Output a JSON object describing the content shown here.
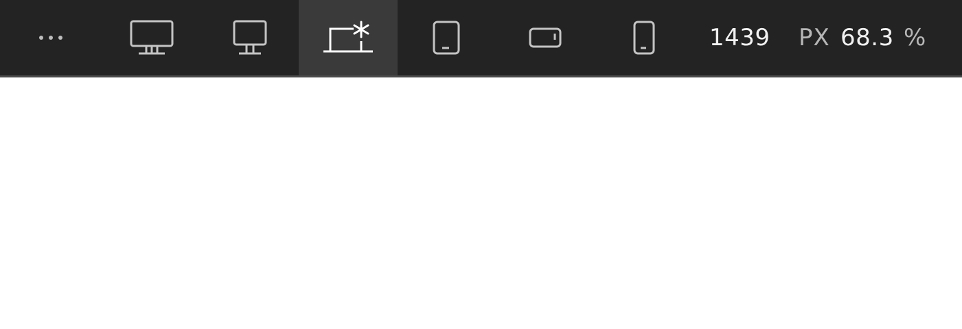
{
  "toolbar": {
    "background": "#232323",
    "active_background": "#3a3a3a",
    "breakpoints": [
      {
        "icon": "more-dots-icon",
        "active": false
      },
      {
        "icon": "desktop-large-icon",
        "active": false
      },
      {
        "icon": "desktop-icon",
        "active": false
      },
      {
        "icon": "laptop-base-icon",
        "active": true
      },
      {
        "icon": "tablet-portrait-icon",
        "active": false
      },
      {
        "icon": "mobile-landscape-icon",
        "active": false
      },
      {
        "icon": "mobile-portrait-icon",
        "active": false
      }
    ],
    "width_value": "1439",
    "width_unit": "PX",
    "zoom_value": "68.3",
    "zoom_unit": "%"
  }
}
